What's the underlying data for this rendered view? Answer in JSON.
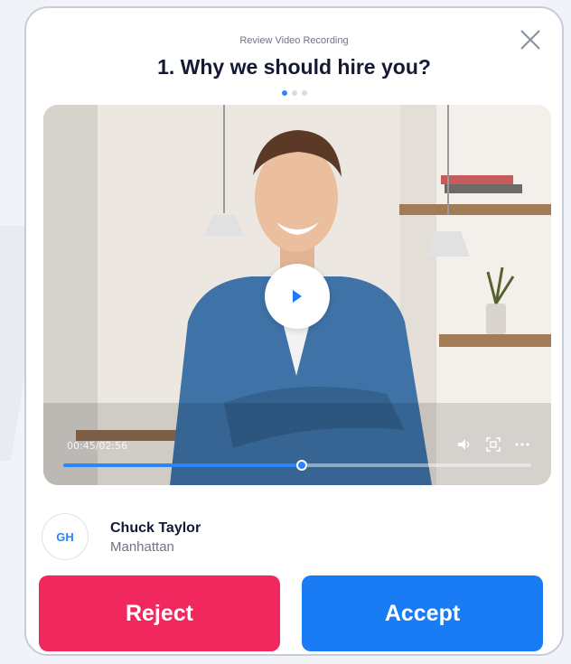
{
  "header": {
    "kicker": "Review Video Recording",
    "question": "1. Why we should hire you?"
  },
  "pagination": {
    "total": 3,
    "active_index": 0
  },
  "video": {
    "timecode": "00:45/02:56",
    "progress_fraction": 0.51,
    "controls": [
      "volume-icon",
      "fullscreen-icon",
      "more-icon"
    ],
    "play_icon": "play-icon"
  },
  "candidate": {
    "initials": "GH",
    "name": "Chuck Taylor",
    "location": "Manhattan"
  },
  "actions": {
    "reject_label": "Reject",
    "accept_label": "Accept"
  },
  "colors": {
    "accent": "#1a7cf5",
    "reject": "#f0285e",
    "title": "#151a33",
    "muted": "#6f7487"
  }
}
